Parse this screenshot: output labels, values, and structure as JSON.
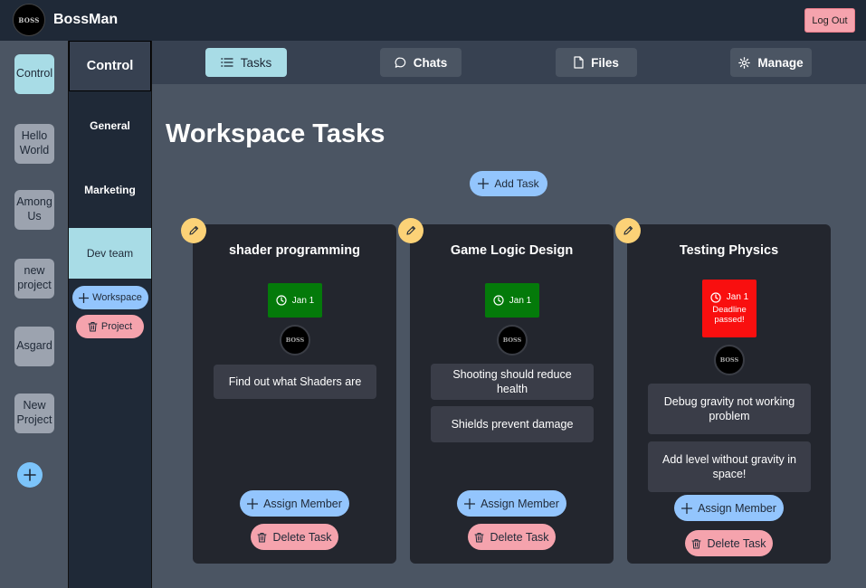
{
  "app": {
    "name": "BossMan",
    "logo_text": "BOSS",
    "logout_label": "Log Out"
  },
  "projects": {
    "items": [
      {
        "label": "Control"
      },
      {
        "label": "Hello World"
      },
      {
        "label": "Among Us"
      },
      {
        "label": "new project"
      },
      {
        "label": "Asgard"
      },
      {
        "label": "New Project"
      }
    ],
    "add_icon": "plus-icon"
  },
  "workspaces": {
    "header": "Control",
    "items": [
      {
        "label": "General"
      },
      {
        "label": "Marketing"
      },
      {
        "label": "Dev team"
      }
    ],
    "add_workspace_label": "Workspace",
    "delete_project_label": "Project"
  },
  "tabs": [
    {
      "label": "Tasks",
      "icon": "list-icon"
    },
    {
      "label": "Chats",
      "icon": "chat-bubble-icon"
    },
    {
      "label": "Files",
      "icon": "file-icon"
    },
    {
      "label": "Manage",
      "icon": "gear-icon"
    }
  ],
  "main": {
    "title": "Workspace Tasks",
    "add_task_label": "Add Task",
    "cards": [
      {
        "title": "shader programming",
        "deadline": "Jan 1",
        "deadline_passed": false,
        "member_avatar": "BOSS",
        "subtasks": [
          "Find out what Shaders are"
        ],
        "assign_label": "Assign Member",
        "delete_label": "Delete Task"
      },
      {
        "title": "Game Logic Design",
        "deadline": "Jan 1",
        "deadline_passed": false,
        "member_avatar": "BOSS",
        "subtasks": [
          "Shooting should reduce health",
          "Shields prevent damage"
        ],
        "assign_label": "Assign Member",
        "delete_label": "Delete Task"
      },
      {
        "title": "Testing Physics",
        "deadline": "Jan 1",
        "deadline_passed": true,
        "deadline_passed_text": "Deadline passed!",
        "member_avatar": "BOSS",
        "subtasks": [
          "Debug gravity not working problem",
          "Add level without gravity in space!"
        ],
        "assign_label": "Assign Member",
        "delete_label": "Delete Task"
      }
    ]
  },
  "colors": {
    "accent": "#a8dce6",
    "blue_button": "#93c5fd",
    "pink_button": "#f5a3ad",
    "deadline_ok": "#047a0a",
    "deadline_overdue": "#f90f0f",
    "edit_button": "#fcd277"
  }
}
